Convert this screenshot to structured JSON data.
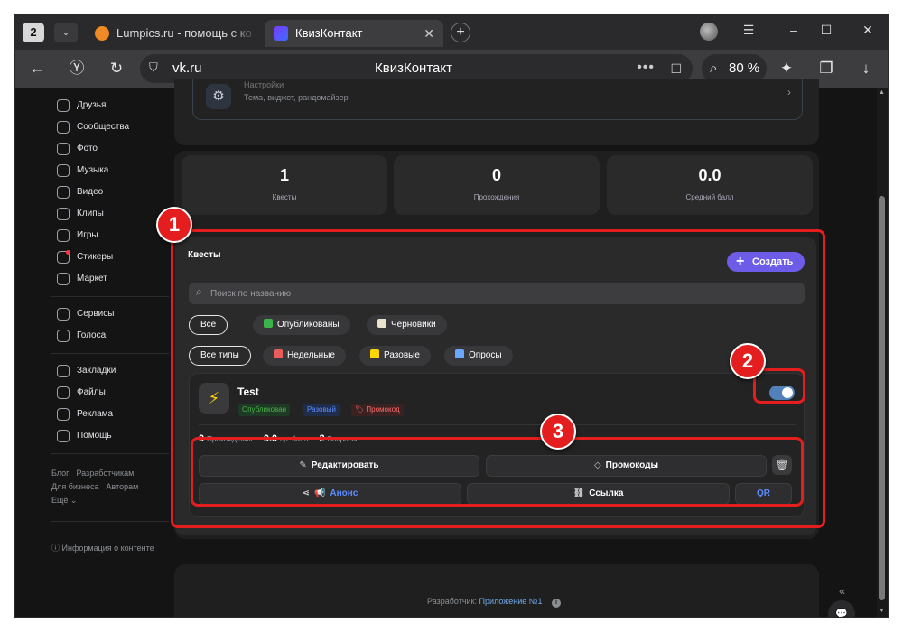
{
  "browser": {
    "tab_count": "2",
    "tabs": [
      {
        "label": "Lumpics.ru - помощь с ко"
      },
      {
        "label": "КвизКонтакт"
      }
    ],
    "new_tab": "+",
    "url_domain": "vk.ru",
    "page_title": "КвизКонтакт",
    "zoom": "80 %"
  },
  "sidebar": {
    "items": [
      {
        "label": "Друзья"
      },
      {
        "label": "Сообщества"
      },
      {
        "label": "Фото"
      },
      {
        "label": "Музыка"
      },
      {
        "label": "Видео"
      },
      {
        "label": "Клипы"
      },
      {
        "label": "Игры"
      },
      {
        "label": "Стикеры"
      },
      {
        "label": "Маркет"
      },
      {
        "label": "Сервисы"
      },
      {
        "label": "Голоса"
      },
      {
        "label": "Закладки"
      },
      {
        "label": "Файлы"
      },
      {
        "label": "Реклама"
      },
      {
        "label": "Помощь"
      }
    ],
    "footer_links": [
      "Блог",
      "Разработчикам",
      "Для бизнеса",
      "Авторам",
      "Ещё ⌄"
    ],
    "info": "ⓘ Информация о контенте"
  },
  "settings": {
    "title": "Настройки",
    "subtitle": "Тема, виджет, рандомайзер"
  },
  "stats": [
    {
      "value": "1",
      "label": "Квесты"
    },
    {
      "value": "0",
      "label": "Прохождения"
    },
    {
      "value": "0.0",
      "label": "Средний балл"
    }
  ],
  "quests": {
    "title": "Квесты",
    "create_label": "Создать",
    "search_placeholder": "Поиск по названию",
    "status_filters": [
      "Все",
      "Опубликованы",
      "Черновики"
    ],
    "type_filters": [
      "Все типы",
      "Недельные",
      "Разовые",
      "Опросы"
    ],
    "card": {
      "name": "Test",
      "tags": [
        "Опубликован",
        "Разовый",
        "Промокод"
      ],
      "stats": [
        {
          "value": "0",
          "label": "Прохождения"
        },
        {
          "value": "0.0",
          "label": "ср. балл"
        },
        {
          "value": "2",
          "label": "Вопросы"
        }
      ],
      "toggle_on": true,
      "actions": {
        "edit": "Редактировать",
        "promo": "Промокоды",
        "announce": "Анонс",
        "link": "Ссылка",
        "qr": "QR"
      }
    }
  },
  "footer": {
    "developer_label": "Разработчик:",
    "developer_link": "Приложение №1"
  },
  "annotations": [
    "1",
    "2",
    "3"
  ],
  "colors": {
    "highlight": "#e41e1e",
    "accent": "#6c5ce7",
    "toggle": "#5181b8"
  }
}
